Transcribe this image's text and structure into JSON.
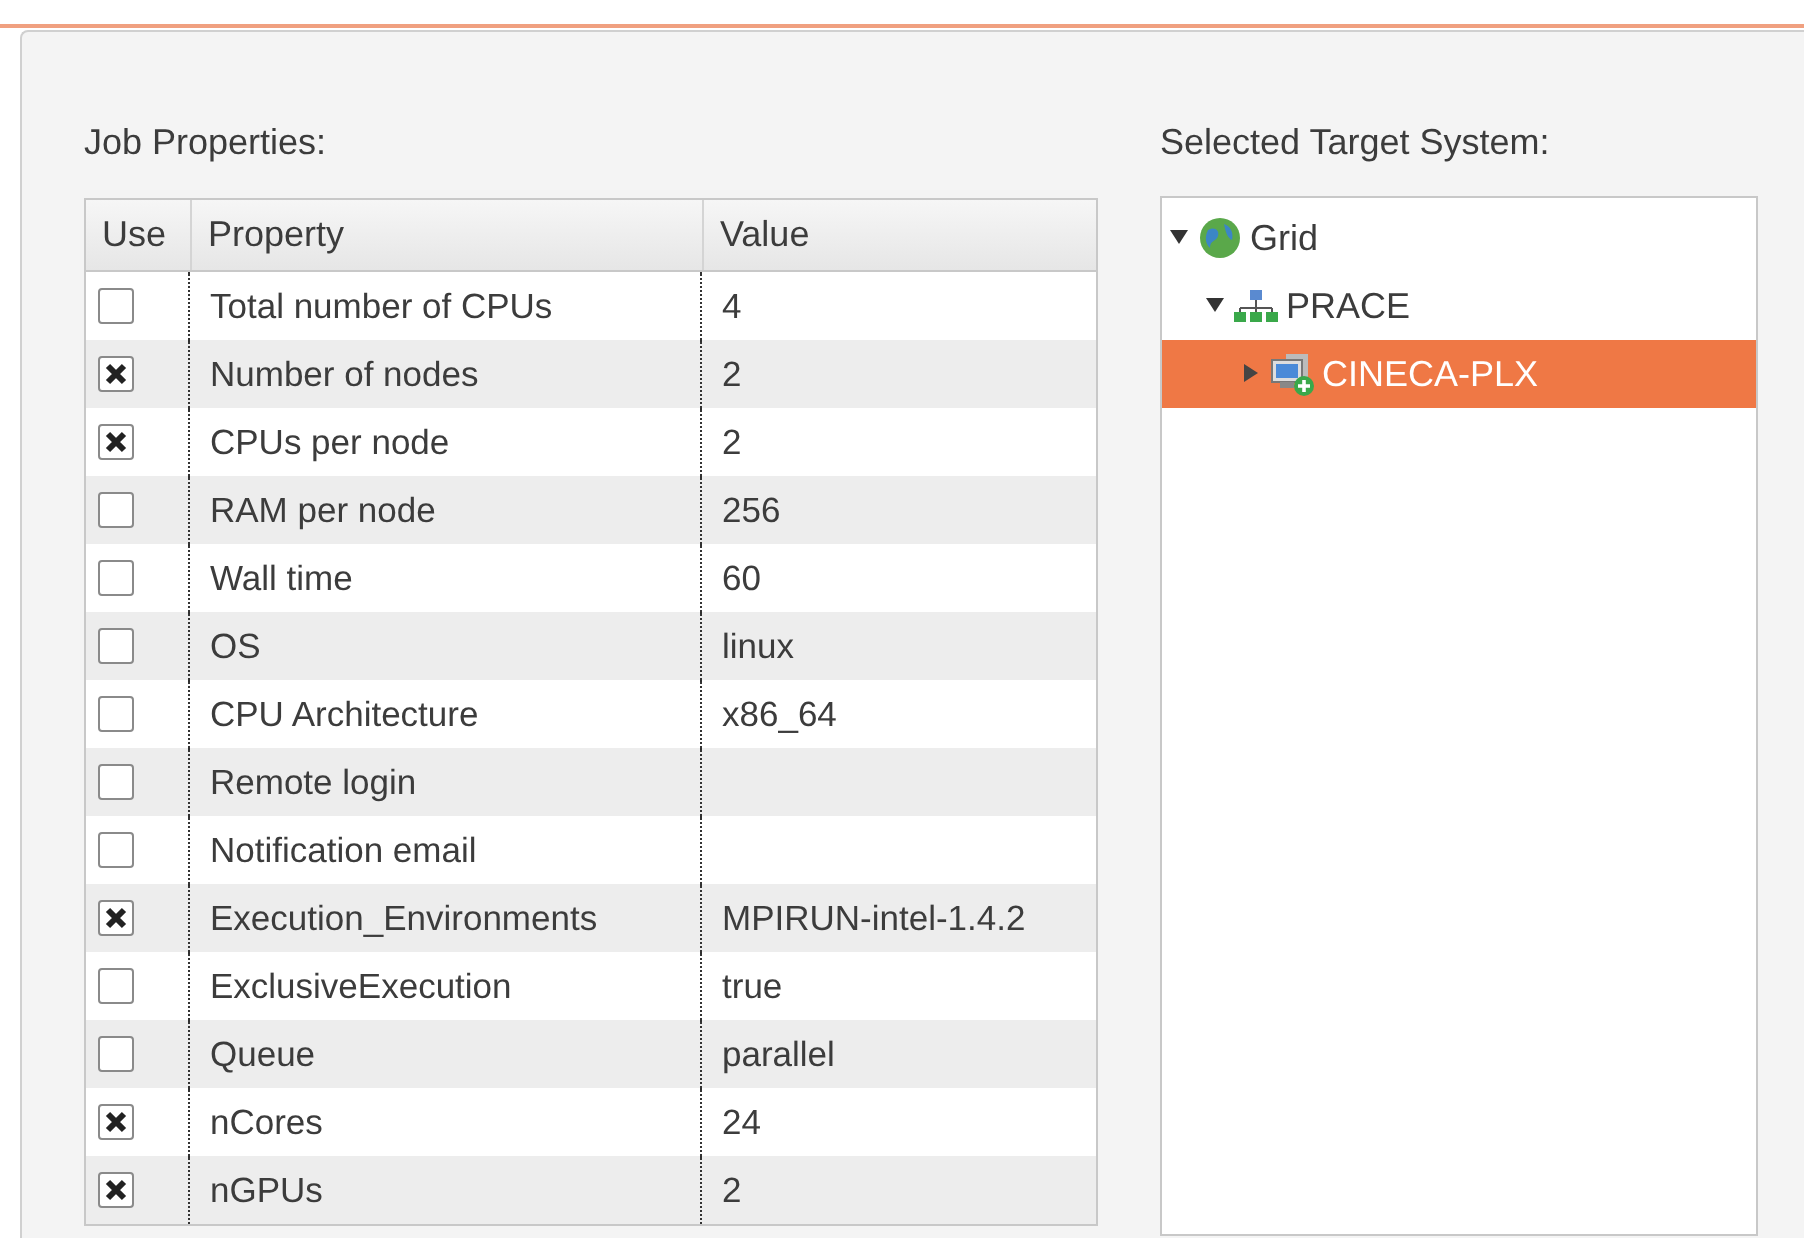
{
  "job_properties": {
    "title": "Job Properties:",
    "columns": [
      "Use",
      "Property",
      "Value"
    ],
    "rows": [
      {
        "checked": false,
        "property": "Total number of CPUs",
        "value": "4"
      },
      {
        "checked": true,
        "property": "Number of nodes",
        "value": "2"
      },
      {
        "checked": true,
        "property": "CPUs per node",
        "value": "2"
      },
      {
        "checked": false,
        "property": "RAM per node",
        "value": "256"
      },
      {
        "checked": false,
        "property": "Wall time",
        "value": "60"
      },
      {
        "checked": false,
        "property": "OS",
        "value": "linux"
      },
      {
        "checked": false,
        "property": "CPU Architecture",
        "value": "x86_64"
      },
      {
        "checked": false,
        "property": "Remote login",
        "value": ""
      },
      {
        "checked": false,
        "property": "Notification email",
        "value": ""
      },
      {
        "checked": true,
        "property": "Execution_Environments",
        "value": "MPIRUN-intel-1.4.2"
      },
      {
        "checked": false,
        "property": "ExclusiveExecution",
        "value": "true"
      },
      {
        "checked": false,
        "property": "Queue",
        "value": "parallel"
      },
      {
        "checked": true,
        "property": "nCores",
        "value": "24"
      },
      {
        "checked": true,
        "property": "nGPUs",
        "value": "2"
      }
    ]
  },
  "target_system": {
    "title": "Selected Target System:",
    "tree": [
      {
        "label": "Grid",
        "kind": "grid",
        "expanded": true,
        "selected": false,
        "children": [
          {
            "label": "PRACE",
            "kind": "network",
            "expanded": true,
            "selected": false,
            "children": [
              {
                "label": "CINECA-PLX",
                "kind": "computer",
                "expanded": false,
                "selected": true
              }
            ]
          }
        ]
      }
    ]
  }
}
